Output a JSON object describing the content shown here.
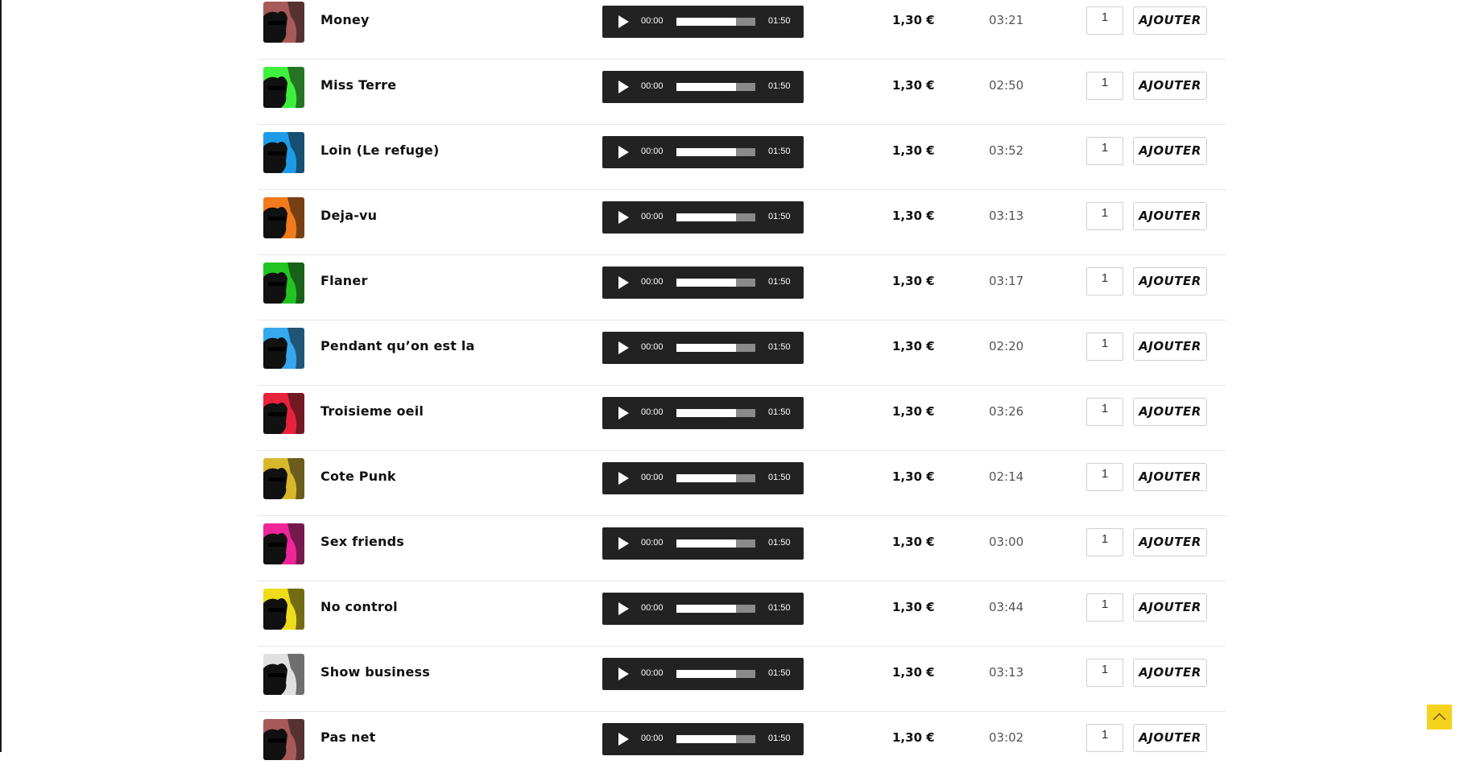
{
  "colors": {
    "accent": "#f5d31c",
    "player_bg": "#222222"
  },
  "tracks": [
    {
      "title": "Money",
      "time_current": "00:00",
      "time_total": "01:50",
      "progress": 0.76,
      "price": "1,30 €",
      "duration": "03:21",
      "quantity": "1",
      "add_label": "AJOUTER",
      "cover_color": "#a85a5a"
    },
    {
      "title": "Miss Terre",
      "time_current": "00:00",
      "time_total": "01:50",
      "progress": 0.76,
      "price": "1,30 €",
      "duration": "02:50",
      "quantity": "1",
      "add_label": "AJOUTER",
      "cover_color": "#3ef03e"
    },
    {
      "title": "Loin (Le refuge)",
      "time_current": "00:00",
      "time_total": "01:50",
      "progress": 0.76,
      "price": "1,30 €",
      "duration": "03:52",
      "quantity": "1",
      "add_label": "AJOUTER",
      "cover_color": "#1e9be8"
    },
    {
      "title": "Deja-vu",
      "time_current": "00:00",
      "time_total": "01:50",
      "progress": 0.76,
      "price": "1,30 €",
      "duration": "03:13",
      "quantity": "1",
      "add_label": "AJOUTER",
      "cover_color": "#f27a1a"
    },
    {
      "title": "Flaner",
      "time_current": "00:00",
      "time_total": "01:50",
      "progress": 0.76,
      "price": "1,30 €",
      "duration": "03:17",
      "quantity": "1",
      "add_label": "AJOUTER",
      "cover_color": "#22c422"
    },
    {
      "title": "Pendant qu’on est la",
      "time_current": "00:00",
      "time_total": "01:50",
      "progress": 0.76,
      "price": "1,30 €",
      "duration": "02:20",
      "quantity": "1",
      "add_label": "AJOUTER",
      "cover_color": "#35a8f0"
    },
    {
      "title": "Troisieme oeil",
      "time_current": "00:00",
      "time_total": "01:50",
      "progress": 0.76,
      "price": "1,30 €",
      "duration": "03:26",
      "quantity": "1",
      "add_label": "AJOUTER",
      "cover_color": "#e8223a"
    },
    {
      "title": "Cote Punk",
      "time_current": "00:00",
      "time_total": "01:50",
      "progress": 0.76,
      "price": "1,30 €",
      "duration": "02:14",
      "quantity": "1",
      "add_label": "AJOUTER",
      "cover_color": "#d8b82a"
    },
    {
      "title": "Sex friends",
      "time_current": "00:00",
      "time_total": "01:50",
      "progress": 0.76,
      "price": "1,30 €",
      "duration": "03:00",
      "quantity": "1",
      "add_label": "AJOUTER",
      "cover_color": "#f0259a"
    },
    {
      "title": "No control",
      "time_current": "00:00",
      "time_total": "01:50",
      "progress": 0.76,
      "price": "1,30 €",
      "duration": "03:44",
      "quantity": "1",
      "add_label": "AJOUTER",
      "cover_color": "#eedc1a"
    },
    {
      "title": "Show business",
      "time_current": "00:00",
      "time_total": "01:50",
      "progress": 0.76,
      "price": "1,30 €",
      "duration": "03:13",
      "quantity": "1",
      "add_label": "AJOUTER",
      "cover_color": "#e0e0e0"
    },
    {
      "title": "Pas net",
      "time_current": "00:00",
      "time_total": "01:50",
      "progress": 0.76,
      "price": "1,30 €",
      "duration": "03:02",
      "quantity": "1",
      "add_label": "AJOUTER",
      "cover_color": "#a85a5a"
    }
  ],
  "scroll_top": {
    "icon": "chevron-up-icon"
  }
}
